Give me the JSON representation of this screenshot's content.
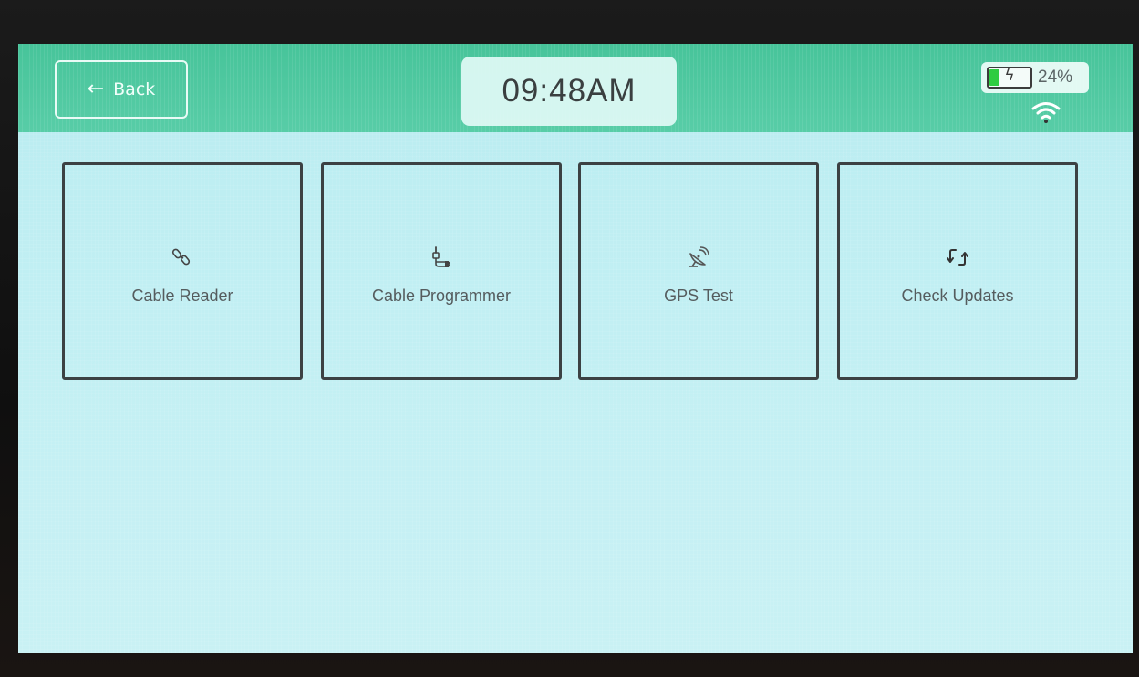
{
  "header": {
    "back_label": "Back",
    "time": "09:48AM",
    "battery_percent_text": "24%",
    "battery_level": 0.24,
    "charging": true,
    "accent_color": "#4fc9a0"
  },
  "tiles": [
    {
      "label": "Cable Reader",
      "icon": "cable-connector-icon"
    },
    {
      "label": "Cable Programmer",
      "icon": "cable-plug-icon"
    },
    {
      "label": "GPS Test",
      "icon": "satellite-dish-icon"
    },
    {
      "label": "Check Updates",
      "icon": "refresh-arrows-icon"
    }
  ],
  "colors": {
    "background": "#c1eff3",
    "header": "#4fc9a0",
    "tile_border": "#3c4143",
    "battery_fill": "#2ecc40"
  }
}
